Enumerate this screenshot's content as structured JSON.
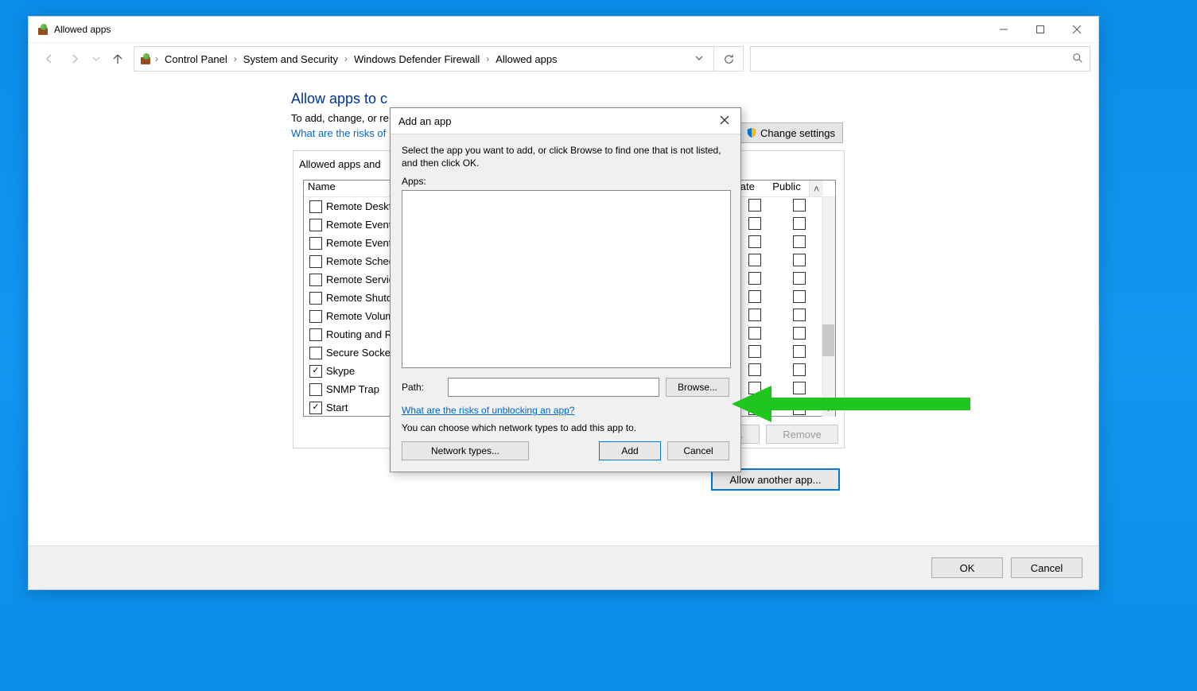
{
  "window": {
    "title": "Allowed apps"
  },
  "breadcrumb": {
    "b0": "Control Panel",
    "b1": "System and Security",
    "b2": "Windows Defender Firewall",
    "b3": "Allowed apps"
  },
  "page": {
    "heading": "Allow apps to communicate through Windows Defender Firewall",
    "heading_visible": "Allow apps to c",
    "subtitle": "To add, change, or remove allowed apps and ports, click Change settings.",
    "subtitle_visible": "To add, change, or re",
    "risks_link": "What are the risks of allowing an app to communicate?",
    "risks_link_visible": "What are the risks of",
    "change_settings": "Change settings",
    "group_label": "Allowed apps and features:",
    "group_label_visible": "Allowed apps and",
    "cols": {
      "name": "Name",
      "private": "Private",
      "private_visible": "rivate",
      "public": "Public"
    },
    "details": "Details...",
    "remove": "Remove",
    "allow_another": "Allow another app...",
    "ok": "OK",
    "cancel": "Cancel"
  },
  "apps": [
    {
      "name": "Remote Desktop",
      "name_visible": "Remote Deskto",
      "checked": false,
      "priv": false,
      "pub": false
    },
    {
      "name": "Remote Event Log Management",
      "name_visible": "Remote Event L",
      "checked": false,
      "priv": false,
      "pub": false
    },
    {
      "name": "Remote Event Monitor",
      "name_visible": "Remote Event M",
      "checked": false,
      "priv": false,
      "pub": false
    },
    {
      "name": "Remote Scheduled Tasks Management",
      "name_visible": "Remote Schedu",
      "checked": false,
      "priv": false,
      "pub": false
    },
    {
      "name": "Remote Service Management",
      "name_visible": "Remote Service",
      "checked": false,
      "priv": false,
      "pub": false
    },
    {
      "name": "Remote Shutdown",
      "name_visible": "Remote Shutdo",
      "checked": false,
      "priv": false,
      "pub": false
    },
    {
      "name": "Remote Volume Management",
      "name_visible": "Remote Volume",
      "checked": false,
      "priv": false,
      "pub": false
    },
    {
      "name": "Routing and Remote Access",
      "name_visible": "Routing and Re",
      "checked": false,
      "priv": false,
      "pub": false
    },
    {
      "name": "Secure Socket Tunneling Protocol",
      "name_visible": "Secure Socket T",
      "checked": false,
      "priv": false,
      "pub": false
    },
    {
      "name": "Skype",
      "name_visible": "Skype",
      "checked": true,
      "priv": false,
      "pub": false
    },
    {
      "name": "SNMP Trap",
      "name_visible": "SNMP Trap",
      "checked": false,
      "priv": false,
      "pub": false
    },
    {
      "name": "Start",
      "name_visible": "Start",
      "checked": true,
      "priv": true,
      "pub": true
    }
  ],
  "dialog": {
    "title": "Add an app",
    "instruction": "Select the app you want to add, or click Browse to find one that is not listed, and then click OK.",
    "apps_label": "Apps:",
    "path_label": "Path:",
    "path_value": "",
    "browse": "Browse...",
    "risks_link": "What are the risks of unblocking an app?",
    "network_hint": "You can choose which network types to add this app to.",
    "network_types": "Network types...",
    "add": "Add",
    "cancel": "Cancel"
  }
}
